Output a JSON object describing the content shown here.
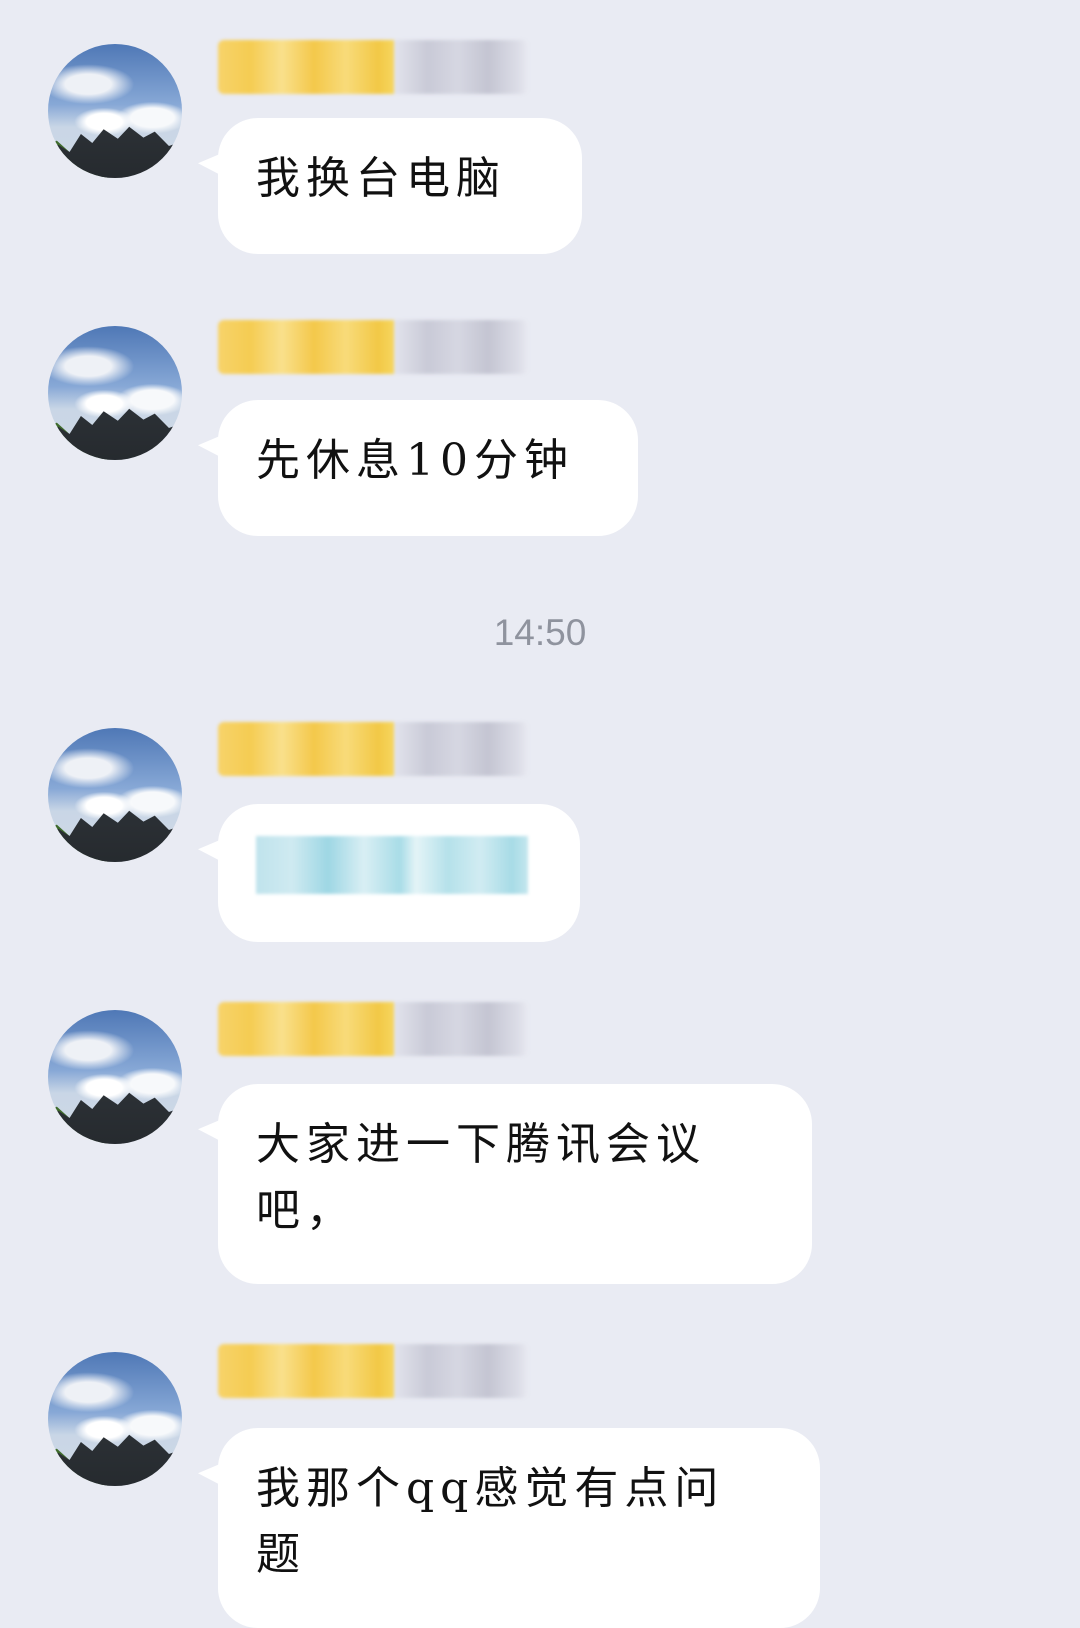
{
  "chat": {
    "timestamp": "14:50",
    "messages": [
      {
        "text": "我换台电脑"
      },
      {
        "text": "先休息10分钟"
      },
      {
        "text": ""
      },
      {
        "text": "大家进一下腾讯会议\n吧，"
      },
      {
        "text": "我那个qq感觉有点问\n题"
      }
    ]
  }
}
